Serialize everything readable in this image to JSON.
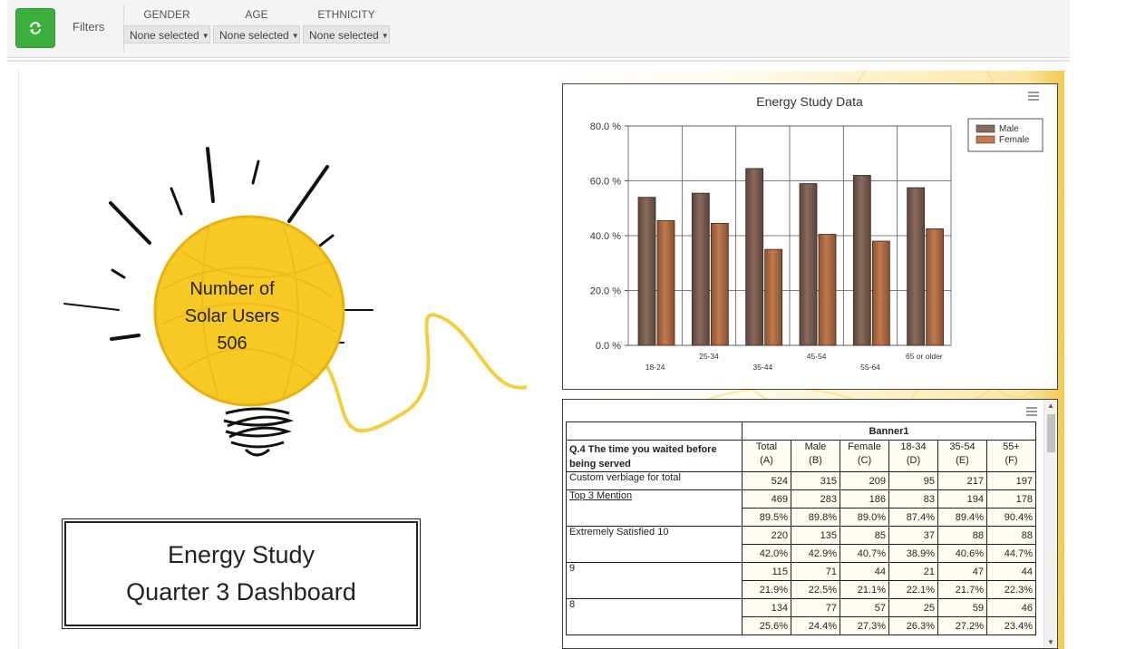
{
  "toolbar": {
    "refresh_icon": "refresh-icon",
    "filters_label": "Filters",
    "filters": [
      {
        "name": "GENDER",
        "value": "None selected"
      },
      {
        "name": "AGE",
        "value": "None selected"
      },
      {
        "name": "ETHNICITY",
        "value": "None selected"
      }
    ]
  },
  "hero": {
    "line1": "Number of",
    "line2": "Solar Users",
    "count": "506"
  },
  "title_box": {
    "line1": "Energy Study",
    "line2": "Quarter 3 Dashboard"
  },
  "chart_data": {
    "type": "bar",
    "title": "Energy Study Data",
    "categories": [
      "18-24",
      "25-34",
      "35-44",
      "45-54",
      "55-64",
      "65 or older"
    ],
    "series": [
      {
        "name": "Male",
        "values": [
          54.0,
          55.5,
          64.5,
          59.0,
          62.0,
          57.5
        ]
      },
      {
        "name": "Female",
        "values": [
          45.5,
          44.5,
          35.0,
          40.5,
          38.0,
          42.5
        ]
      }
    ],
    "yticks": [
      "0.0 %",
      "20.0 %",
      "40.0 %",
      "60.0 %",
      "80.0 %"
    ],
    "ylim": [
      0,
      80
    ],
    "grid": true,
    "legend": "top-right",
    "colors": {
      "male": "#8a6a5c",
      "female": "#c07a4e"
    }
  },
  "table": {
    "banner": "Banner1",
    "question_prefix": "Q.4",
    "question_text": "The time you waited before being served",
    "columns": [
      {
        "name": "Total",
        "letter": "(A)"
      },
      {
        "name": "Male",
        "letter": "(B)"
      },
      {
        "name": "Female",
        "letter": "(C)"
      },
      {
        "name": "18-34",
        "letter": "(D)"
      },
      {
        "name": "35-54",
        "letter": "(E)"
      },
      {
        "name": "55+",
        "letter": "(F)"
      }
    ],
    "rows": [
      {
        "label": "Custom verbiage for total",
        "values": [
          "524",
          "315",
          "209",
          "95",
          "217",
          "197"
        ],
        "pct": null
      },
      {
        "label": "Top 3 Mention",
        "values": [
          "469",
          "283",
          "186",
          "83",
          "194",
          "178"
        ],
        "pct": [
          "89.5%",
          "89.8%",
          "89.0%",
          "87.4%",
          "89.4%",
          "90.4%"
        ]
      },
      {
        "label": "Extremely Satisfied 10",
        "values": [
          "220",
          "135",
          "85",
          "37",
          "88",
          "88"
        ],
        "pct": [
          "42.0%",
          "42.9%",
          "40.7%",
          "38.9%",
          "40.6%",
          "44.7%"
        ]
      },
      {
        "label": "9",
        "values": [
          "115",
          "71",
          "44",
          "21",
          "47",
          "44"
        ],
        "pct": [
          "21.9%",
          "22.5%",
          "21.1%",
          "22.1%",
          "21.7%",
          "22.3%"
        ]
      },
      {
        "label": "8",
        "values": [
          "134",
          "77",
          "57",
          "25",
          "59",
          "46"
        ],
        "pct": [
          "25.6%",
          "24.4%",
          "27.3%",
          "26.3%",
          "27.2%",
          "23.4%"
        ]
      }
    ]
  }
}
